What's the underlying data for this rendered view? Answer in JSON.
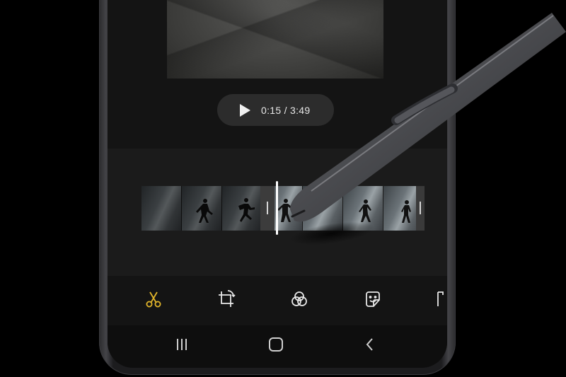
{
  "player": {
    "time_display": "0:15 / 3:49"
  },
  "toolbar": {
    "items": [
      {
        "icon": "scissors-icon",
        "active": true,
        "color": "#e2b52a"
      },
      {
        "icon": "crop-rotate-icon",
        "active": false
      },
      {
        "icon": "filter-icon",
        "active": false
      },
      {
        "icon": "sticker-icon",
        "active": false
      },
      {
        "icon": "text-icon",
        "active": false
      }
    ]
  },
  "navbar": {
    "items": [
      "recent-apps-icon",
      "home-icon",
      "back-icon"
    ]
  },
  "colors": {
    "accent": "#e2b52a",
    "background": "#141414",
    "pill": "#2c2c2c",
    "playhead": "#ffffff"
  }
}
